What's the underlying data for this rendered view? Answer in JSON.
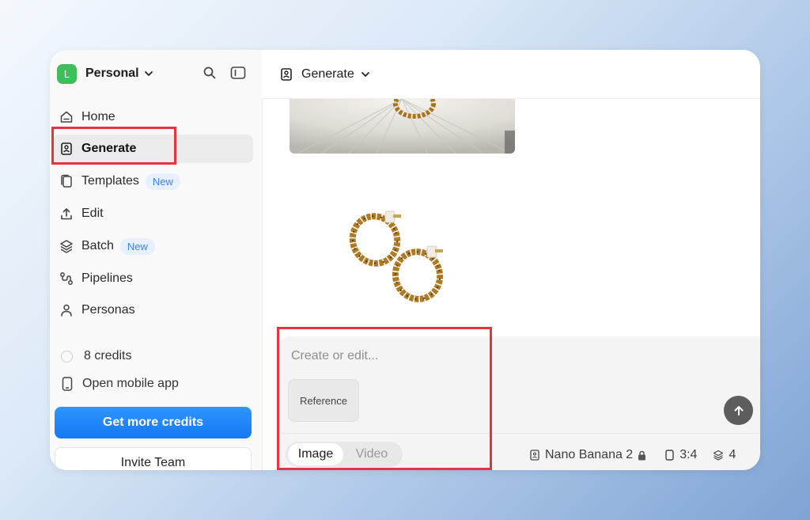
{
  "workspace": {
    "avatar_letter": "L",
    "name": "Personal",
    "avatar_color": "#3fbf5a"
  },
  "nav": [
    {
      "label": "Home",
      "icon": "home-icon",
      "active": false
    },
    {
      "label": "Generate",
      "icon": "generate-icon",
      "active": true
    },
    {
      "label": "Templates",
      "icon": "templates-icon",
      "badge": "New"
    },
    {
      "label": "Edit",
      "icon": "upload-icon"
    },
    {
      "label": "Batch",
      "icon": "layers-icon",
      "badge": "New"
    },
    {
      "label": "Pipelines",
      "icon": "pipelines-icon"
    },
    {
      "label": "Personas",
      "icon": "person-icon"
    }
  ],
  "credits": {
    "label": "8 credits"
  },
  "mobile": {
    "label": "Open mobile app"
  },
  "cta": {
    "label": "Get more credits",
    "color": "#1478f2"
  },
  "invite": {
    "label": "Invite Team"
  },
  "header": {
    "title": "Generate"
  },
  "composer": {
    "placeholder": "Create or edit...",
    "reference_label": "Reference",
    "mode_tabs": [
      {
        "label": "Image",
        "selected": true
      },
      {
        "label": "Video",
        "selected": false
      }
    ],
    "model": "Nano Banana 2",
    "aspect": "3:4",
    "count": "4"
  },
  "highlight_color": "#e53340"
}
